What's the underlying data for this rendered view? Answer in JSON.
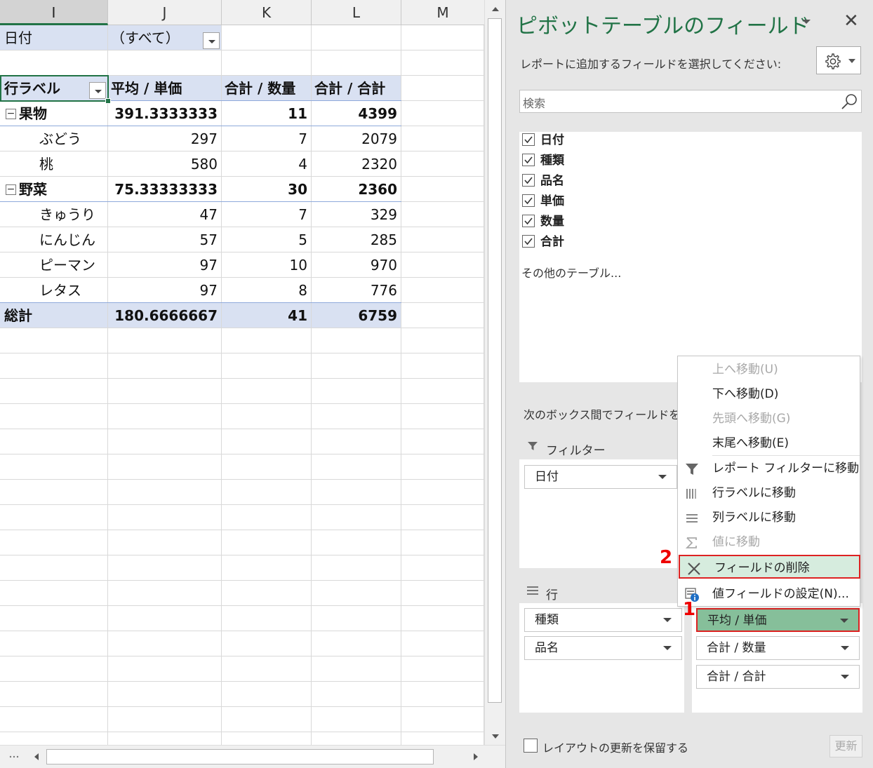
{
  "sheet": {
    "columns": [
      "I",
      "J",
      "K",
      "L",
      "M"
    ],
    "filter": {
      "label": "日付",
      "value": "（すべて）"
    },
    "headers": {
      "row_labels": "行ラベル",
      "avg_price": "平均 / 単価",
      "sum_qty": "合計 / 数量",
      "sum_total": "合計 / 合計"
    },
    "rows": [
      {
        "label": "果物",
        "avg": "391.3333333",
        "qty": "11",
        "total": "4399",
        "group": true,
        "expander": "−"
      },
      {
        "label": "ぶどう",
        "avg": "297",
        "qty": "7",
        "total": "2079",
        "group": false
      },
      {
        "label": "桃",
        "avg": "580",
        "qty": "4",
        "total": "2320",
        "group": false
      },
      {
        "label": "野菜",
        "avg": "75.33333333",
        "qty": "30",
        "total": "2360",
        "group": true,
        "expander": "−"
      },
      {
        "label": "きゅうり",
        "avg": "47",
        "qty": "7",
        "total": "329",
        "group": false
      },
      {
        "label": "にんじん",
        "avg": "57",
        "qty": "5",
        "total": "285",
        "group": false
      },
      {
        "label": "ピーマン",
        "avg": "97",
        "qty": "10",
        "total": "970",
        "group": false
      },
      {
        "label": "レタス",
        "avg": "97",
        "qty": "8",
        "total": "776",
        "group": false
      }
    ],
    "grand_total": {
      "label": "総計",
      "avg": "180.6666667",
      "qty": "41",
      "total": "6759"
    }
  },
  "pane": {
    "title": "ピボットテーブルのフィールド",
    "close_glyph": "✕",
    "instruction": "レポートに追加するフィールドを選択してください:",
    "search_placeholder": "検索",
    "fields": [
      {
        "label": "日付",
        "checked": true
      },
      {
        "label": "種類",
        "checked": true
      },
      {
        "label": "品名",
        "checked": true
      },
      {
        "label": "単価",
        "checked": true
      },
      {
        "label": "数量",
        "checked": true
      },
      {
        "label": "合計",
        "checked": true
      }
    ],
    "other_tables": "その他のテーブル...",
    "drag_instruction": "次のボックス間でフィールドをドラッグしてください:",
    "areas": {
      "filter_label": "フィルター",
      "filter_items": [
        "日付"
      ],
      "rows_label": "行",
      "rows_items": [
        "種類",
        "品名"
      ],
      "values_items": [
        "平均 / 単価",
        "合計 / 数量",
        "合計 / 合計"
      ]
    },
    "defer_label": "レイアウトの更新を保留する",
    "update_button": "更新"
  },
  "context_menu": {
    "items": [
      {
        "label": "上へ移動(U)",
        "enabled": false,
        "icon": ""
      },
      {
        "label": "下へ移動(D)",
        "enabled": true,
        "icon": ""
      },
      {
        "label": "先頭へ移動(G)",
        "enabled": false,
        "icon": ""
      },
      {
        "label": "末尾へ移動(E)",
        "enabled": true,
        "icon": ""
      },
      {
        "label": "レポート フィルターに移動",
        "enabled": true,
        "icon": "filter-icon"
      },
      {
        "label": "行ラベルに移動",
        "enabled": true,
        "icon": "row-labels-icon"
      },
      {
        "label": "列ラベルに移動",
        "enabled": true,
        "icon": "column-labels-icon"
      },
      {
        "label": "値に移動",
        "enabled": false,
        "icon": "sigma-icon"
      },
      {
        "label": "フィールドの削除",
        "enabled": true,
        "icon": "remove-x-icon",
        "highlighted": true
      },
      {
        "label": "値フィールドの設定(N)...",
        "enabled": true,
        "icon": "field-settings-icon"
      }
    ]
  },
  "annotations": {
    "step1": "1",
    "step2": "2"
  },
  "colors": {
    "accent_green": "#217346",
    "header_band": "#d9e1f2",
    "highlight_red": "#dd2222",
    "active_pill": "#86bf9a"
  }
}
